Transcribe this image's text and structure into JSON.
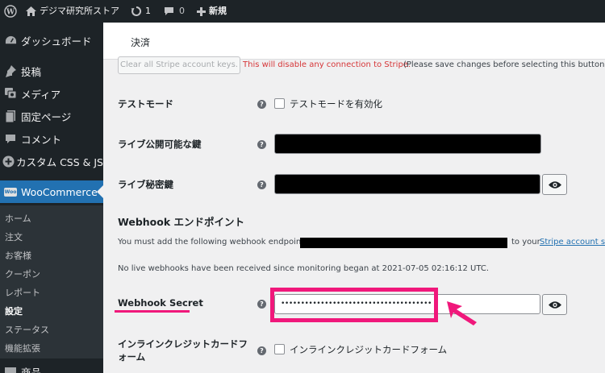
{
  "adminbar": {
    "site_name": "デジマ研究所ストア",
    "updates_count": "1",
    "comments_count": "0",
    "new_label": "新規"
  },
  "sidebar": {
    "items": [
      {
        "label": "ダッシュボード",
        "icon": "dashboard-icon"
      },
      {
        "label": "投稿",
        "icon": "pin-icon"
      },
      {
        "label": "メディア",
        "icon": "media-icon"
      },
      {
        "label": "固定ページ",
        "icon": "page-icon"
      },
      {
        "label": "コメント",
        "icon": "comment-icon"
      },
      {
        "label": "カスタム CSS & JS",
        "icon": "plus-circle-icon"
      },
      {
        "label": "WooCommerce",
        "icon": "woo-icon",
        "badge": "Woo"
      }
    ],
    "submenu": [
      "ホーム",
      "注文",
      "お客様",
      "クーポン",
      "レポート",
      "設定",
      "ステータス",
      "機能拡張"
    ],
    "active_submenu": "設定",
    "next_item": "商品"
  },
  "header": {
    "title": "決済"
  },
  "main": {
    "clear_button": "Clear all Stripe account keys.",
    "warning": "This will disable any connection to Stripe.",
    "note": "(Please save changes before selecting this button.)",
    "test_mode": {
      "label": "テストモード",
      "checkbox_label": "テストモードを有効化"
    },
    "live_publishable_key": {
      "label": "ライブ公開可能な鍵"
    },
    "live_secret_key": {
      "label": "ライブ秘密鍵"
    },
    "webhook": {
      "heading": "Webhook エンドポイント",
      "desc_prefix": "You must add the following webhook endpoint",
      "desc_suffix": "to your",
      "link_text": "Stripe account se",
      "status": "No live webhooks have been received since monitoring began at 2021-07-05 02:16:12 UTC."
    },
    "webhook_secret": {
      "label": "Webhook Secret",
      "value": "••••••••••••••••••••••••••••••••••••••"
    },
    "inline_card": {
      "label_line1": "インラインクレジットカードフ",
      "label_line2": "ォーム",
      "checkbox_label": "インラインクレジットカードフォーム"
    },
    "help_glyph": "?"
  },
  "colors": {
    "accent": "#2271b1",
    "highlight": "#f0187b",
    "warning": "#d63638",
    "adminbar": "#1d2327"
  }
}
